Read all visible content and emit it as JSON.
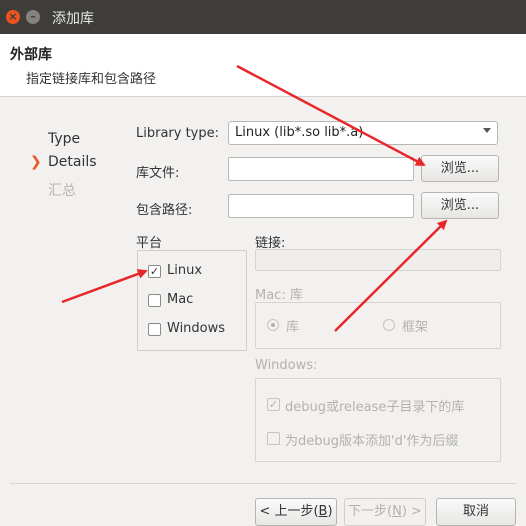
{
  "window": {
    "title": "添加库",
    "close_glyph": "×",
    "minimize_glyph": "–"
  },
  "header": {
    "title": "外部库",
    "subtitle": "指定链接库和包含路径"
  },
  "steps": {
    "items": [
      "Type",
      "Details",
      "汇总"
    ],
    "current_marker": "❯"
  },
  "form": {
    "library_type_label": "Library type:",
    "library_type_value": "Linux (lib*.so lib*.a)",
    "lib_file_label": "库文件:",
    "lib_file_value": "",
    "include_path_label": "包含路径:",
    "include_path_value": "",
    "browse_label": "浏览..."
  },
  "platform": {
    "label": "平台",
    "options": [
      {
        "label": "Linux",
        "checked": true
      },
      {
        "label": "Mac",
        "checked": false
      },
      {
        "label": "Windows",
        "checked": false
      }
    ]
  },
  "link": {
    "label": "链接:",
    "value": "",
    "mac_label": "Mac: 库",
    "mac_options": [
      {
        "label": "库",
        "selected": true
      },
      {
        "label": "框架",
        "selected": false
      }
    ],
    "windows_label": "Windows:",
    "windows_options": [
      {
        "label": "debug或release子目录下的库",
        "checked": true
      },
      {
        "label": "为debug版本添加'd'作为后缀",
        "checked": false
      }
    ]
  },
  "buttons": {
    "back_text": "< 上一步(",
    "back_mnemonic": "B",
    "back_suffix": ")",
    "next_text": "下一步(",
    "next_mnemonic": "N",
    "next_suffix": ") >",
    "cancel": "取消"
  },
  "colors": {
    "accent": "#e95420",
    "annotation_arrow": "#e8272b",
    "titlebar": "#3e3d39"
  },
  "icons": {
    "dropdown": "chevron-down-icon",
    "check": "check-icon",
    "current_step": "chevron-right-icon"
  }
}
